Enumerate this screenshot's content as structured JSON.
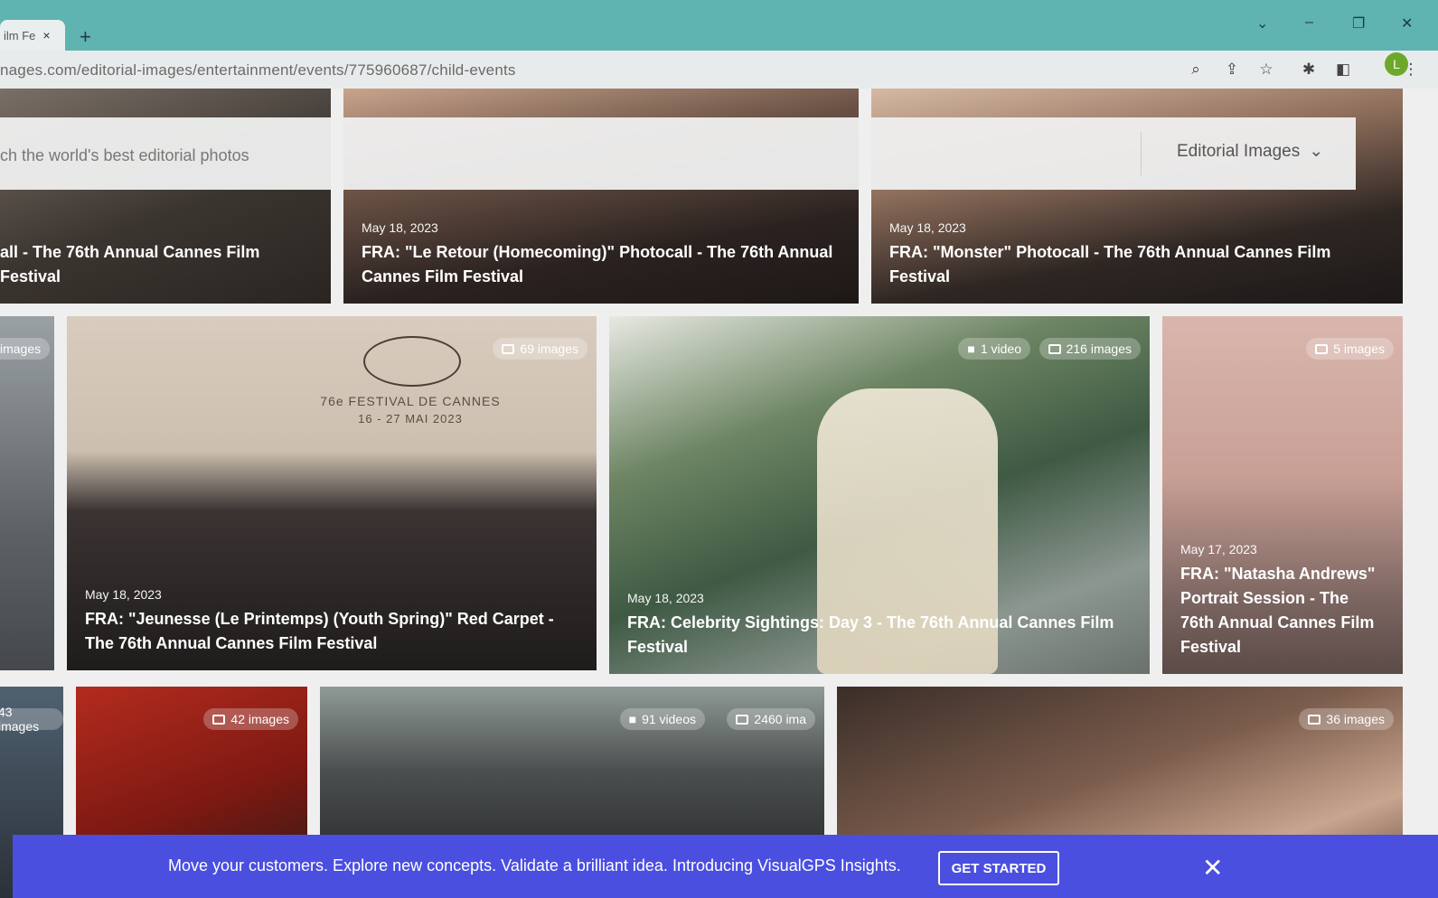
{
  "browser": {
    "tab_title": "ilm Fe",
    "tab_close": "×",
    "new_tab": "+",
    "url": "nages.com/editorial-images/entertainment/events/775960687/child-events",
    "profile_initial": "L"
  },
  "search": {
    "placeholder": "ch the world's best editorial photos",
    "dropdown_label": "Editorial Images"
  },
  "row1": [
    {
      "title": "all - The 76th Annual Cannes Film Festival"
    },
    {
      "date": "May 18, 2023",
      "title": "FRA: \"Le Retour (Homecoming)\" Photocall - The 76th Annual Cannes Film Festival"
    },
    {
      "date": "May 18, 2023",
      "title": "FRA: \"Monster\" Photocall - The 76th Annual Cannes Film Festival"
    }
  ],
  "row2": [
    {
      "badge": "images"
    },
    {
      "badge": "69 images",
      "poster_line1": "76e FESTIVAL DE CANNES",
      "poster_line2": "16 - 27 MAI 2023",
      "date": "May 18, 2023",
      "title": "FRA: \"Jeunesse (Le Printemps) (Youth Spring)\" Red Carpet - The 76th Annual Cannes Film Festival"
    },
    {
      "badge_video": "1 video",
      "badge": "216 images",
      "date": "May 18, 2023",
      "title": "FRA: Celebrity Sightings: Day 3 - The 76th Annual Cannes Film Festival"
    },
    {
      "badge": "5 images",
      "date": "May 17, 2023",
      "title": "FRA: \"Natasha Andrews\" Portrait Session - The 76th Annual Cannes Film Festival"
    }
  ],
  "row3": [
    {
      "badge": "43 images"
    },
    {
      "badge": "42 images"
    },
    {
      "badge_video": "91 videos",
      "badge": "2460 ima"
    },
    {
      "badge": "36 images"
    }
  ],
  "banner": {
    "message": "Move your customers. Explore new concepts. Validate a brilliant idea. Introducing VisualGPS Insights.",
    "cta": "GET STARTED",
    "close": "✕"
  }
}
